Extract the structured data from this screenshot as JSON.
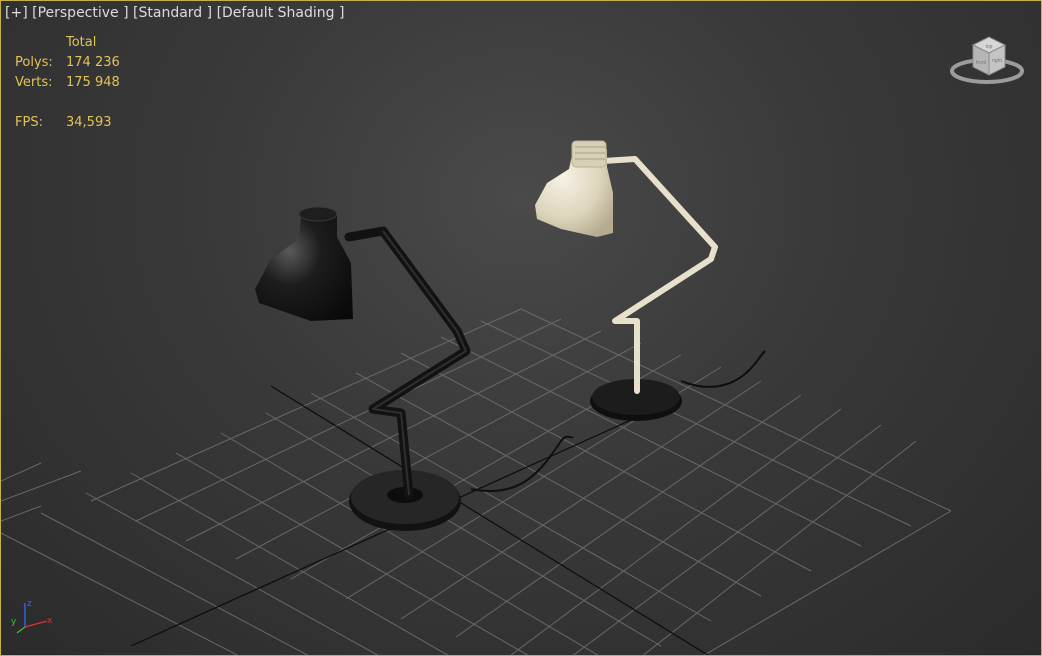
{
  "viewport": {
    "label_parts": [
      "[+]",
      "[Perspective ]",
      "[Standard ]",
      "[Default Shading ]"
    ],
    "border_color": "#c7b144"
  },
  "stats": {
    "header": "Total",
    "polys_label": "Polys:",
    "polys_value": "174 236",
    "verts_label": "Verts:",
    "verts_value": "175 948",
    "fps_label": "FPS:",
    "fps_value": "34,593",
    "text_color": "#e2c357"
  },
  "viewcube": {
    "icon": "viewcube-icon",
    "face_labels": [
      "top",
      "front",
      "right"
    ]
  },
  "axis_tripod": {
    "labels": [
      "z",
      "y",
      "x"
    ],
    "colors": [
      "#2d6bff",
      "#38c038",
      "#e03030"
    ]
  },
  "scene_objects": [
    {
      "name": "black-desk-lamp",
      "color": "#1a1a1a"
    },
    {
      "name": "white-desk-lamp",
      "color": "#e9e2cf"
    }
  ]
}
